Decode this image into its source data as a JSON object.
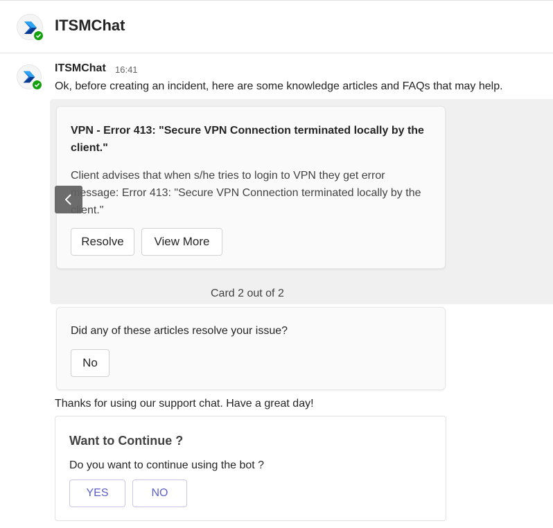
{
  "header": {
    "title": "ITSMChat",
    "avatar_icon": "app-logo-icon",
    "presence": "available"
  },
  "message": {
    "sender": "ITSMChat",
    "time": "16:41",
    "text": "Ok, before creating an incident, here are some knowledge articles and FAQs that may help."
  },
  "carousel": {
    "card": {
      "title": "VPN - Error 413: \"Secure VPN Connection terminated locally by the client.\"",
      "body": "Client advises that when s/he tries to login to VPN they get error message: Error 413: \"Secure VPN Connection terminated locally by the client.\"",
      "buttons": {
        "resolve": "Resolve",
        "view_more": "View More"
      }
    },
    "pager": "Card 2 out of 2",
    "prev_icon": "chevron-left-icon"
  },
  "feedback": {
    "question": "Did any of these articles resolve your issue?",
    "no": "No"
  },
  "thanks": "Thanks for using our support chat. Have a great day!",
  "continue_card": {
    "title": "Want to Continue ?",
    "question": "Do you want to continue using the bot ?",
    "yes": "YES",
    "no": "NO"
  },
  "colors": {
    "accent": "#5b5fc7",
    "presence": "#13a10e",
    "carousel_bg": "#f0f0f0"
  }
}
